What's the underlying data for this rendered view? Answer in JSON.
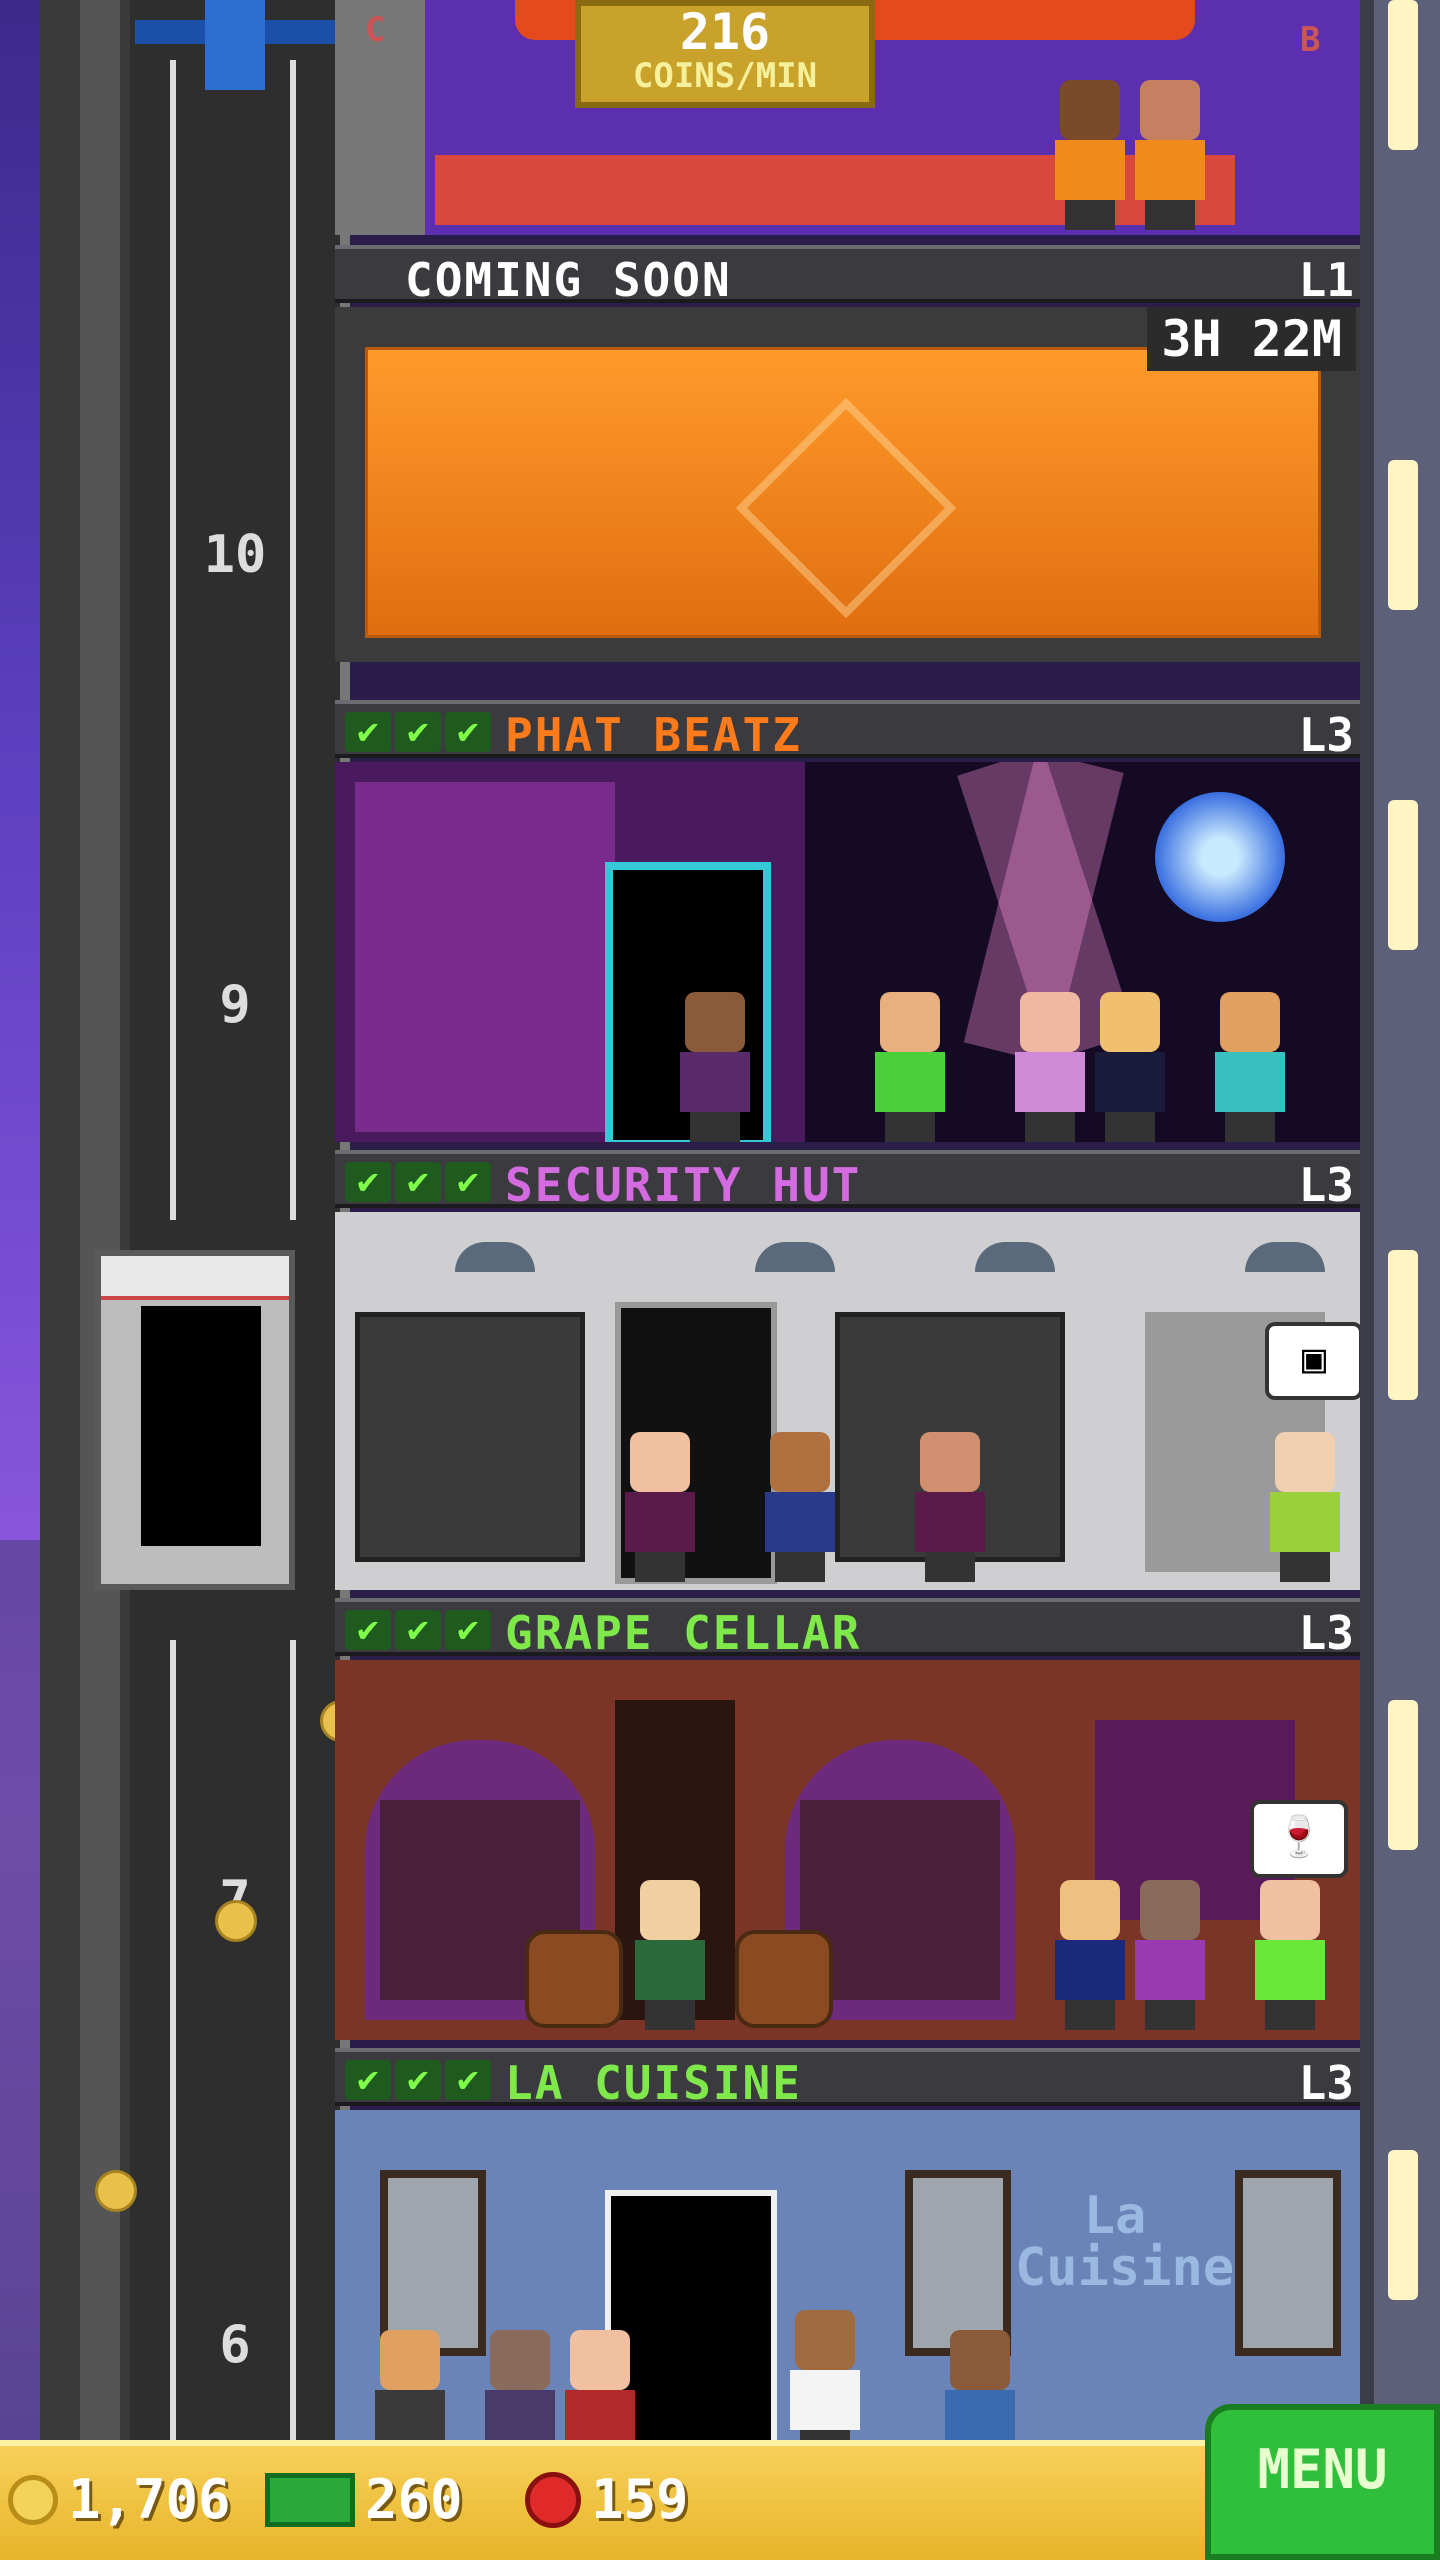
{
  "top_room": {
    "coins_value": "216",
    "coins_unit": "COINS/MIN",
    "elevator_left_letter": "C",
    "elevator_right_letter": "B"
  },
  "shaft": {
    "floor_numbers": [
      "10",
      "9",
      "7",
      "6"
    ]
  },
  "floors": [
    {
      "title": "COMING SOON",
      "level": "L1",
      "timer": "3H 22M",
      "checks": 0
    },
    {
      "title": "PHAT BEATZ",
      "level": "L3",
      "title_color": "#ff7a1a",
      "checks": 3
    },
    {
      "title": "SECURITY HUT",
      "level": "L3",
      "title_color": "#d46be0",
      "checks": 3
    },
    {
      "title": "GRAPE CELLAR",
      "level": "L3",
      "title_color": "#7fe84a",
      "checks": 3
    },
    {
      "title": "LA CUISINE",
      "level": "L3",
      "title_color": "#7fe84a",
      "checks": 3,
      "sign_text": "La Cuisine"
    }
  ],
  "bubbles": {
    "security": "computer-icon",
    "cellar": "wine-glass-icon"
  },
  "bottom_bar": {
    "coins": "1,706",
    "bux": "260",
    "gems": "159",
    "menu_label": "MENU"
  },
  "colors": {
    "menu_button": "#2fbf3a",
    "bottom_bar": "#f1c23e",
    "check": "#7fff4a"
  }
}
